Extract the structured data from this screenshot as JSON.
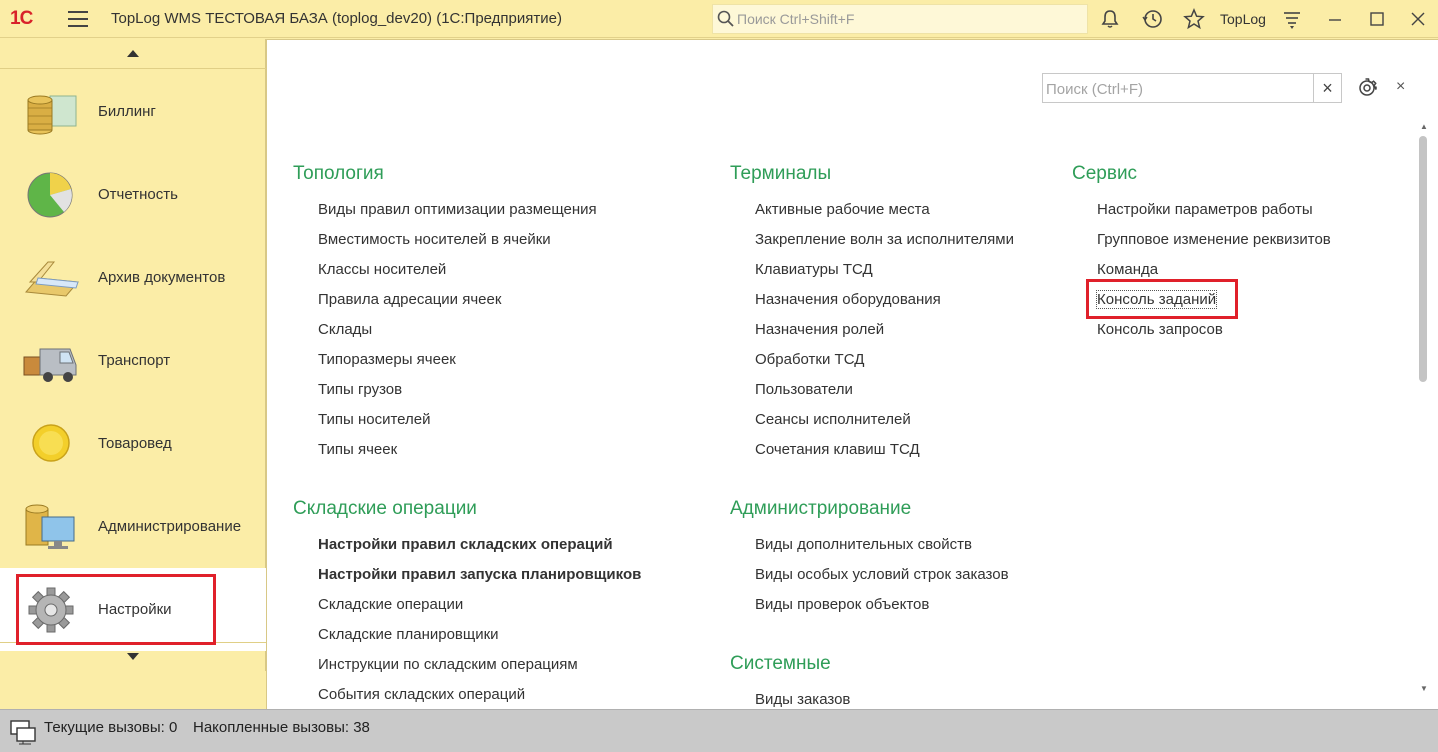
{
  "titlebar": {
    "logo": "1С",
    "app_title": "TopLog WMS   ТЕСТОВАЯ БАЗА (toplog_dev20)  (1С:Предприятие)",
    "search_placeholder": "Поиск Ctrl+Shift+F",
    "user": "TopLog"
  },
  "sidebar": {
    "items": [
      {
        "label": "Биллинг",
        "icon": "coins-icon"
      },
      {
        "label": "Отчетность",
        "icon": "pie-chart-icon"
      },
      {
        "label": "Архив документов",
        "icon": "folder-icon"
      },
      {
        "label": "Транспорт",
        "icon": "truck-icon"
      },
      {
        "label": "Товаровед",
        "icon": "circle-icon"
      },
      {
        "label": "Администрирование",
        "icon": "database-monitor-icon"
      },
      {
        "label": "Настройки",
        "icon": "gear-icon",
        "active": true
      }
    ]
  },
  "main": {
    "search_placeholder": "Поиск (Ctrl+F)",
    "clear_label": "×",
    "close_label": "×",
    "sections": [
      {
        "title": "Топология",
        "links": [
          {
            "label": "Виды правил оптимизации размещения"
          },
          {
            "label": "Вместимость носителей в ячейки"
          },
          {
            "label": "Классы носителей"
          },
          {
            "label": "Правила адресации ячеек"
          },
          {
            "label": "Склады"
          },
          {
            "label": "Типоразмеры ячеек"
          },
          {
            "label": "Типы грузов"
          },
          {
            "label": "Типы носителей"
          },
          {
            "label": "Типы ячеек"
          }
        ]
      },
      {
        "title": "Складские операции",
        "links": [
          {
            "label": "Настройки правил складских операций",
            "bold": true
          },
          {
            "label": "Настройки правил запуска планировщиков",
            "bold": true
          },
          {
            "label": "Складские операции"
          },
          {
            "label": "Складские планировщики"
          },
          {
            "label": "Инструкции по складским операциям"
          },
          {
            "label": "События складских операций"
          }
        ]
      },
      {
        "title": "Терминалы",
        "links": [
          {
            "label": "Активные рабочие места"
          },
          {
            "label": "Закрепление волн за исполнителями"
          },
          {
            "label": "Клавиатуры ТСД"
          },
          {
            "label": "Назначения оборудования"
          },
          {
            "label": "Назначения ролей"
          },
          {
            "label": "Обработки ТСД"
          },
          {
            "label": "Пользователи"
          },
          {
            "label": "Сеансы исполнителей"
          },
          {
            "label": "Сочетания клавиш ТСД"
          }
        ]
      },
      {
        "title": "Администрирование",
        "links": [
          {
            "label": "Виды дополнительных свойств"
          },
          {
            "label": "Виды особых условий строк заказов"
          },
          {
            "label": "Виды проверок объектов"
          }
        ]
      },
      {
        "title": "Системные",
        "links": [
          {
            "label": "Виды заказов"
          }
        ]
      },
      {
        "title": "Сервис",
        "links": [
          {
            "label": "Настройки параметров работы"
          },
          {
            "label": "Групповое изменение реквизитов"
          },
          {
            "label": "Команда"
          },
          {
            "label": "Консоль заданий",
            "focused": true
          },
          {
            "label": "Консоль запросов"
          }
        ]
      }
    ]
  },
  "statusbar": {
    "current_calls": "Текущие вызовы: 0",
    "accumulated_calls": "Накопленные вызовы: 38"
  },
  "colors": {
    "section_title": "#2f9d58",
    "panel_bg": "#fbeda7",
    "highlight_box": "#e0202a"
  }
}
